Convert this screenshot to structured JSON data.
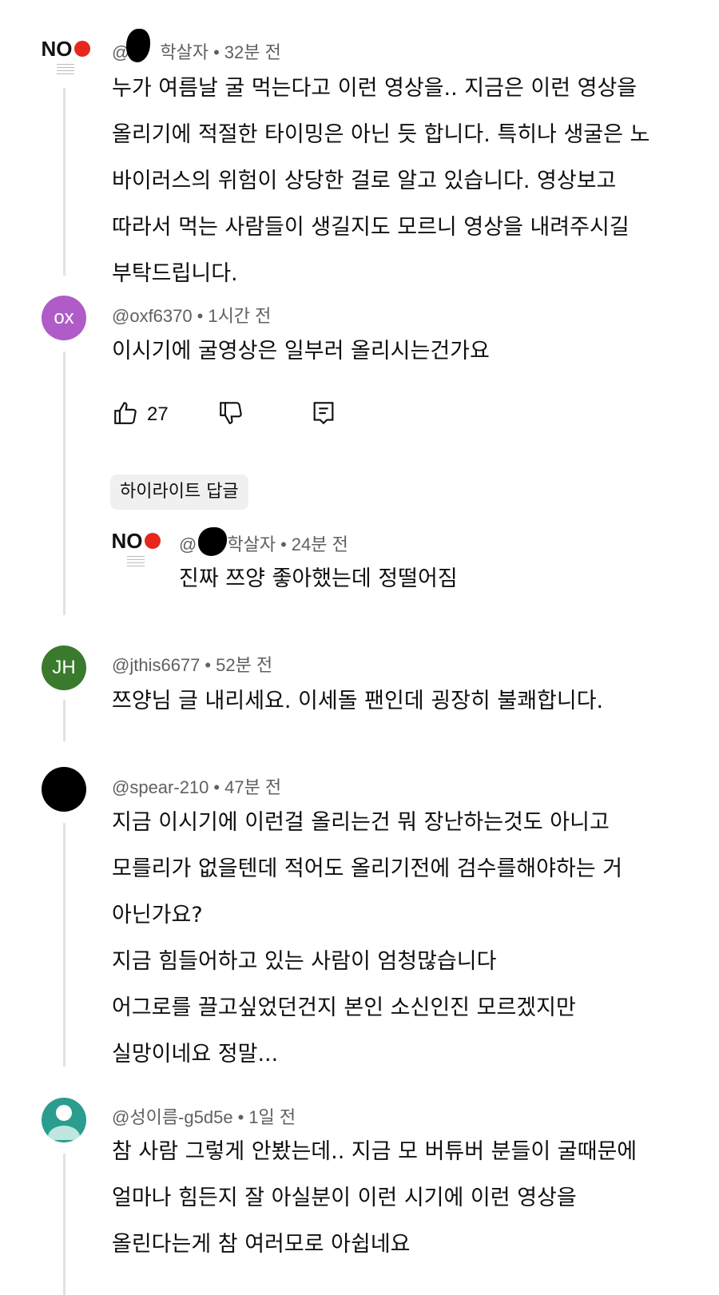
{
  "comments": [
    {
      "username": "@",
      "username_suffix": "학살자",
      "time": "32분 전",
      "text": "누가 여름날 굴 먹는다고 이런 영상을.. 지금은 이런 영상을\n올리기에 적절한 타이밍은 아닌 듯 합니다. 특히나 생굴은 노\n바이러스의 위험이 상당한 걸로 알고 있습니다. 영상보고\n따라서 먹는 사람들이 생길지도 모르니 영상을 내려주시길\n부탁드립니다.",
      "avatar": "NO"
    },
    {
      "username": "@oxf6370",
      "time": "1시간 전",
      "text": "이시기에 굴영상은 일부러 올리시는건가요",
      "avatar": "ox",
      "avatar_color": "#b05cc8",
      "likes": "27",
      "highlight_label": "하이라이트 답글",
      "reply": {
        "username": "@",
        "username_suffix": "학살자",
        "time": "24분 전",
        "text": "진짜 쯔양 좋아했는데 정떨어짐",
        "avatar": "NO"
      }
    },
    {
      "username": "@jthis6677",
      "time": "52분 전",
      "text": "쯔양님 글 내리세요. 이세돌 팬인데 굉장히 불쾌합니다.",
      "avatar": "JH",
      "avatar_color": "#3a7a2c"
    },
    {
      "username": "@spear-210",
      "time": "47분 전",
      "text": "지금 이시기에 이런걸 올리는건 뭐 장난하는것도 아니고\n모를리가 없을텐데 적어도 올리기전에 검수를해야하는 거\n아닌가요?\n지금 힘들어하고 있는 사람이 엄청많습니다\n어그로를 끌고싶었던건지 본인 소신인진 모르겠지만\n실망이네요 정말...",
      "avatar_color": "#000000"
    },
    {
      "username": "@성이름-g5d5e",
      "time": "1일 전",
      "text": "참 사람 그렇게 안봤는데.. 지금 모 버튜버 분들이 굴때문에\n얼마나 힘든지 잘 아실분이 이런 시기에 이런 영상을\n올린다는게 참 여러모로 아쉽네요",
      "avatar_color": "#2a9d8f"
    }
  ],
  "colors": {
    "meta_text": "#606060",
    "chip_bg": "#f0f0f0",
    "no_red": "#e5281e"
  },
  "icons": [
    "thumbs-up-icon",
    "thumbs-down-icon",
    "reply-icon"
  ]
}
